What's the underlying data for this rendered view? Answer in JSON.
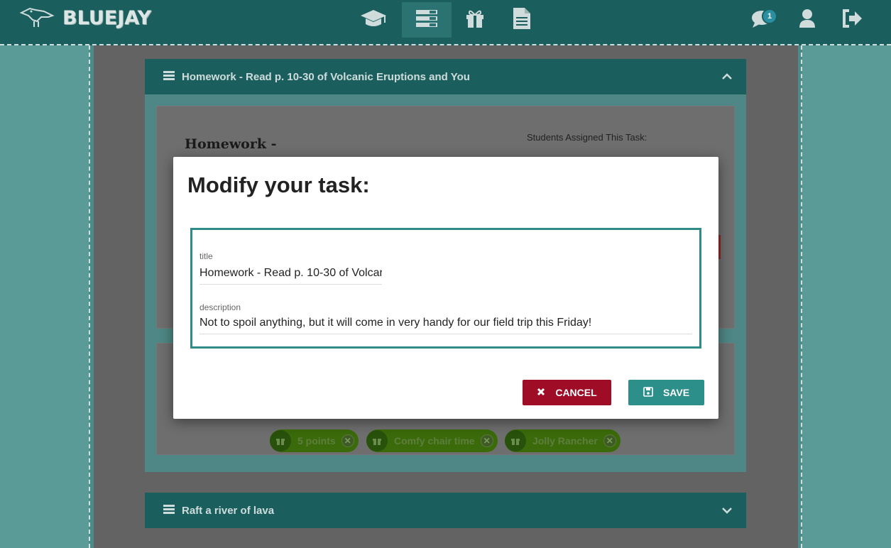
{
  "app": {
    "name": "BLUEJAY"
  },
  "nav": {
    "items": [
      {
        "icon": "graduation-cap-icon",
        "active": false
      },
      {
        "icon": "tasks-list-icon",
        "active": true
      },
      {
        "icon": "gift-icon",
        "active": false
      },
      {
        "icon": "document-icon",
        "active": false
      }
    ],
    "messages_badge": "1"
  },
  "panels": [
    {
      "title": "Homework - Read p. 10-30 of Volcanic Eruptions and You",
      "expanded": true
    },
    {
      "title": "Raft a river of lava",
      "expanded": false
    }
  ],
  "task_card": {
    "title": "Homework -",
    "assigned_label": "Students Assigned This Task:"
  },
  "rewards": [
    {
      "label": "5 points"
    },
    {
      "label": "Comfy chair time"
    },
    {
      "label": "Jolly Rancher"
    }
  ],
  "modal": {
    "heading": "Modify your task:",
    "title_label": "title",
    "title_value": "Homework - Read p. 10-30 of Volcar",
    "description_label": "description",
    "description_value": "Not to spoil anything, but it will come in very handy for our field trip this Friday!",
    "cancel_label": "CANCEL",
    "save_label": "SAVE"
  },
  "colors": {
    "header": "#1a5e5e",
    "accent": "#2d8f8a",
    "cancel": "#9e0c26",
    "reward_chip": "#4a8a0f"
  }
}
